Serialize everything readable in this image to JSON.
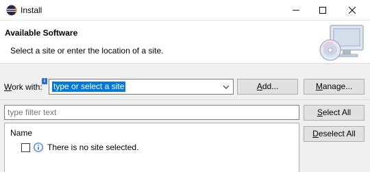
{
  "window": {
    "title": "Install",
    "minimize_glyph": "─",
    "maximize_glyph": "☐",
    "close_glyph": "✕"
  },
  "header": {
    "title": "Available Software",
    "description": "Select a site or enter the location of a site."
  },
  "work_with": {
    "label_mnemonic": "W",
    "label_rest": "ork with:",
    "info_badge": "i",
    "combo_value": "type or select a site"
  },
  "buttons": {
    "add_mnemonic": "A",
    "add_rest": "dd...",
    "manage_pre": "",
    "manage_mnemonic": "M",
    "manage_rest": "anage...",
    "select_all_mnemonic": "S",
    "select_all_rest": "elect All",
    "deselect_all_mnemonic": "D",
    "deselect_all_rest": "eselect All"
  },
  "filter": {
    "placeholder": "type filter text"
  },
  "table": {
    "column_header": "Name",
    "rows": [
      {
        "text": "There is no site selected.",
        "checked": false,
        "icon": "info-icon"
      }
    ]
  },
  "colors": {
    "accent": "#0078d7",
    "info_blue": "#2b6bd6"
  }
}
